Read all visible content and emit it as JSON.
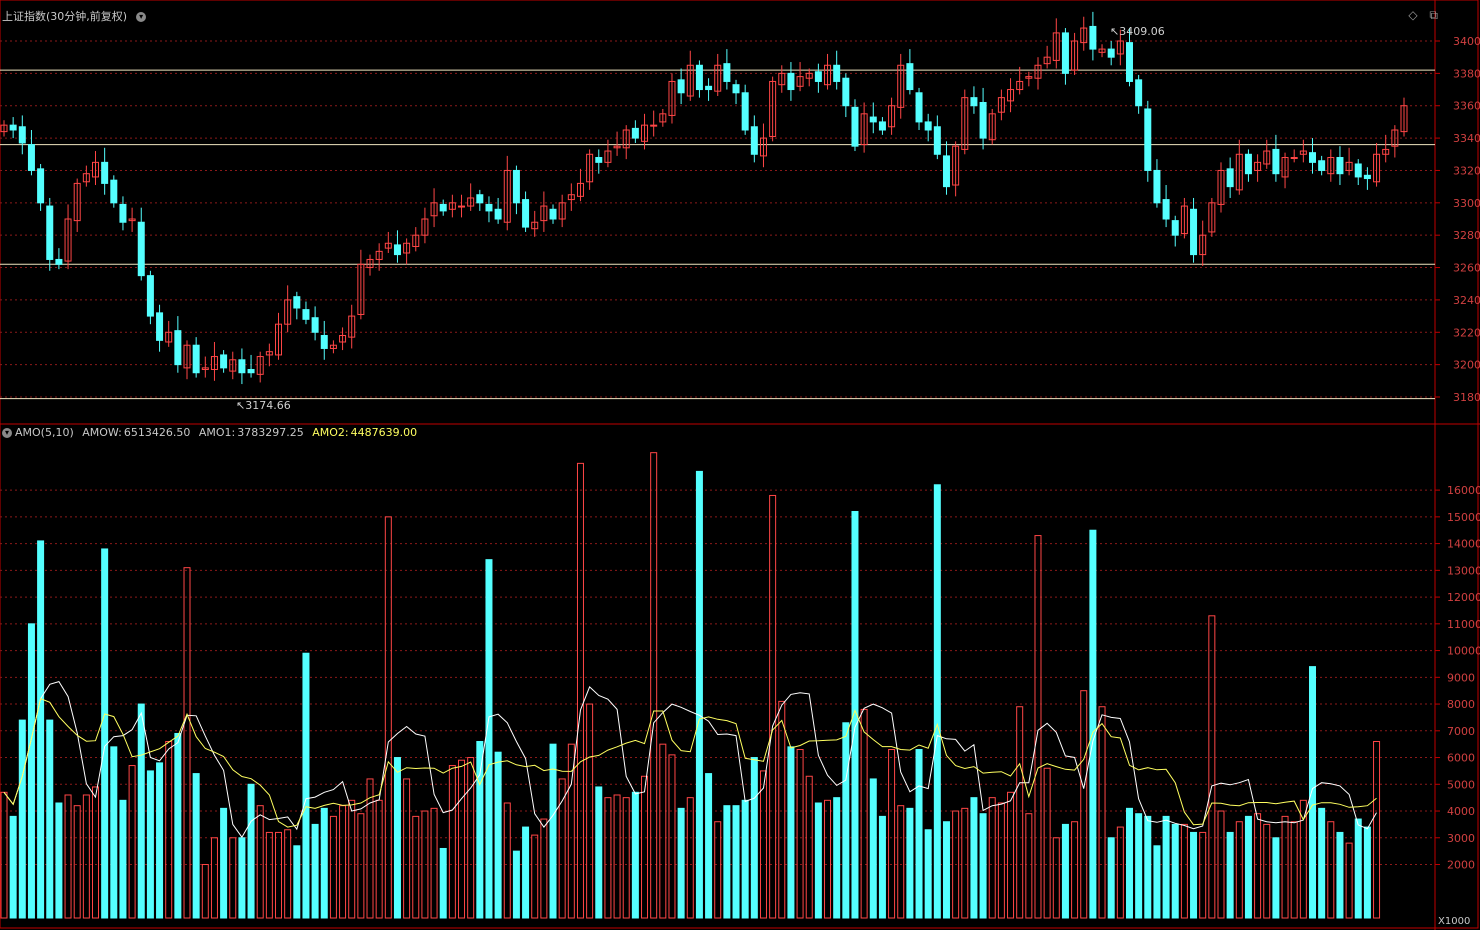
{
  "header": {
    "title": "上证指数(30分钟,前复权)",
    "collapse_icon": "chevron-down-icon"
  },
  "window_icons": {
    "diamond": "◇",
    "restore": "⧉"
  },
  "indicator": {
    "name": "AMO(5,10)",
    "amow_label": "AMOW:",
    "amow_value": "6513426.50",
    "amo1_label": "AMO1:",
    "amo1_value": "3783297.25",
    "amo2_label": "AMO2:",
    "amo2_value": "4487639.00",
    "unit_label": "X1000"
  },
  "colors": {
    "up": "#ff4646",
    "down": "#54ffff",
    "grid": "#8b1a1a",
    "axis": "#c00000",
    "amo1": "#ffffff",
    "amo2": "#ffff60"
  },
  "chart_data": [
    {
      "type": "candlestick",
      "title": "上证指数(30分钟,前复权)",
      "ylim": [
        3170,
        3410
      ],
      "yticks": [
        3180,
        3200,
        3220,
        3240,
        3260,
        3280,
        3300,
        3320,
        3340,
        3360,
        3380,
        3400
      ],
      "h_lines": [
        3174.66,
        3262,
        3336,
        3382
      ],
      "annotations": [
        {
          "text": "3409.06",
          "value": 3409.06
        },
        {
          "text": "3174.66",
          "value": 3174.66
        }
      ],
      "closes": [
        3348,
        3345,
        3337,
        3320,
        3300,
        3265,
        3262,
        3290,
        3312,
        3318,
        3325,
        3312,
        3300,
        3288,
        3290,
        3255,
        3230,
        3215,
        3220,
        3200,
        3212,
        3195,
        3198,
        3205,
        3198,
        3203,
        3195,
        3195,
        3205,
        3208,
        3225,
        3240,
        3235,
        3228,
        3220,
        3210,
        3212,
        3218,
        3230,
        3262,
        3265,
        3270,
        3275,
        3268,
        3275,
        3280,
        3290,
        3300,
        3295,
        3300,
        3298,
        3303,
        3300,
        3295,
        3290,
        3320,
        3300,
        3285,
        3288,
        3298,
        3290,
        3300,
        3305,
        3312,
        3330,
        3325,
        3332,
        3335,
        3345,
        3340,
        3348,
        3348,
        3355,
        3375,
        3368,
        3385,
        3370,
        3370,
        3385,
        3375,
        3368,
        3345,
        3330,
        3340,
        3375,
        3380,
        3370,
        3378,
        3380,
        3375,
        3385,
        3375,
        3360,
        3335,
        3355,
        3350,
        3345,
        3360,
        3385,
        3370,
        3350,
        3345,
        3330,
        3310,
        3335,
        3365,
        3360,
        3340,
        3355,
        3365,
        3370,
        3375,
        3378,
        3385,
        3390,
        3405,
        3380,
        3400,
        3408,
        3395,
        3395,
        3390,
        3400,
        3375,
        3360,
        3320,
        3300,
        3290,
        3280,
        3298,
        3268,
        3280,
        3300,
        3320,
        3310,
        3330,
        3318,
        3325,
        3332,
        3318,
        3328,
        3328,
        3332,
        3325,
        3320,
        3328,
        3318,
        3325,
        3316,
        3315,
        3330,
        3333,
        3345,
        3360
      ],
      "volumes": [
        4700,
        3800,
        7400,
        11000,
        14100,
        7400,
        4300,
        4600,
        4200,
        4600,
        4900,
        13800,
        6400,
        4400,
        5700,
        8000,
        5500,
        5800,
        6600,
        6900,
        13100,
        5400,
        2000,
        3000,
        4100,
        3000,
        3000,
        5000,
        4200,
        3200,
        3200,
        3300,
        2700,
        9900,
        3500,
        4100,
        3800,
        4200,
        4400,
        3900,
        5200,
        4400,
        15000,
        6000,
        5200,
        3800,
        4000,
        4100,
        2600,
        5700,
        5900,
        6000,
        6600,
        13400,
        6200,
        4300,
        2500,
        3400,
        3100,
        3700,
        6500,
        5200,
        6500,
        17000,
        8000,
        4900,
        4500,
        4600,
        4500,
        4700,
        5300,
        17400,
        6500,
        6100,
        4100,
        4500,
        16700,
        5400,
        3600,
        4200,
        4200,
        4400,
        6000,
        5500,
        15800,
        8100,
        6400,
        6300,
        5300,
        4300,
        4400,
        4500,
        7300,
        15200,
        7800,
        5200,
        3800,
        6300,
        4200,
        4100,
        6300,
        3300,
        16200,
        3600,
        4000,
        4100,
        4500,
        3900,
        4500,
        4300,
        4700,
        7900,
        3900,
        14300,
        5600,
        3000,
        3500,
        3600,
        8500,
        14500,
        7900,
        3000,
        3400,
        4100,
        3900,
        3800,
        2700,
        3800,
        3500,
        3500,
        3200,
        3200,
        11300,
        4000,
        3200,
        3600,
        3800,
        3900,
        3500,
        3000,
        3800,
        3600,
        4400,
        9400,
        4100,
        3600,
        3200,
        2800,
        3700,
        3400,
        6600
      ],
      "volume_ylim": [
        0,
        17500
      ],
      "volume_yticks": [
        2000,
        3000,
        4000,
        5000,
        6000,
        7000,
        8000,
        9000,
        10000,
        11000,
        12000,
        13000,
        14000,
        15000,
        16000
      ]
    }
  ]
}
